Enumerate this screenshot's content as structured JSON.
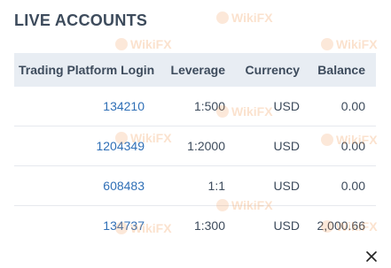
{
  "title": "LIVE ACCOUNTS",
  "columns": [
    "Trading Platform Login",
    "Leverage",
    "Currency",
    "Balance"
  ],
  "rows": [
    {
      "login": "134210",
      "leverage": "1:500",
      "currency": "USD",
      "balance": "0.00"
    },
    {
      "login": "1204349",
      "leverage": "1:2000",
      "currency": "USD",
      "balance": "0.00"
    },
    {
      "login": "608483",
      "leverage": "1:1",
      "currency": "USD",
      "balance": "0.00"
    },
    {
      "login": "134737",
      "leverage": "1:300",
      "currency": "USD",
      "balance": "2,000.66"
    }
  ],
  "watermark": "WikiFX",
  "icons": {
    "close": "close-icon"
  },
  "colors": {
    "header_bg": "#e8edf3",
    "text": "#3d4b5c",
    "link": "#2f6fb6"
  }
}
